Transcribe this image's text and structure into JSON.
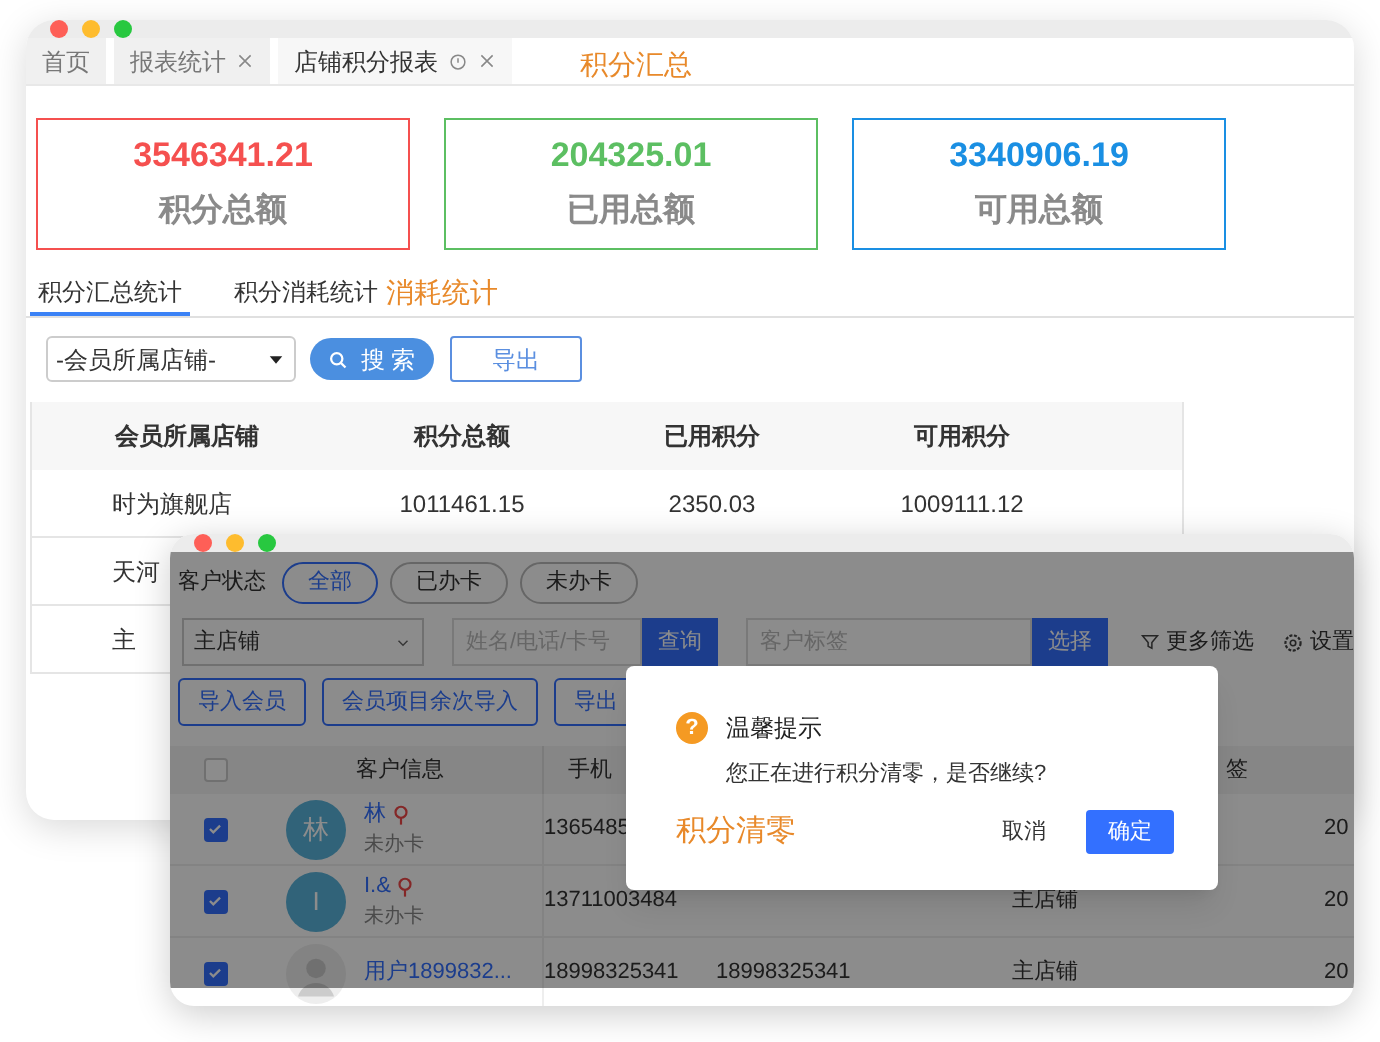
{
  "main_window": {
    "tabs": [
      {
        "label": "首页",
        "closable": false,
        "selected": false
      },
      {
        "label": "报表统计",
        "closable": true,
        "selected": false
      },
      {
        "label": "店铺积分报表",
        "closable": true,
        "selected": true
      }
    ],
    "tab_note": "积分汇总",
    "summary_cards": [
      {
        "value": "3546341.21",
        "label": "积分总额",
        "color": "#f5504f"
      },
      {
        "value": "204325.01",
        "label": "已用总额",
        "color": "#5cbf62"
      },
      {
        "value": "3340906.19",
        "label": "可用总额",
        "color": "#1a8fe3"
      }
    ],
    "sub_tabs": [
      {
        "label": "积分汇总统计",
        "selected": true
      },
      {
        "label": "积分消耗统计",
        "selected": false
      }
    ],
    "sub_tab_note": "消耗统计",
    "store_select": "-会员所属店铺-",
    "search_button": "搜 索",
    "export_button": "导出",
    "table": {
      "columns": [
        "会员所属店铺",
        "积分总额",
        "已用积分",
        "可用积分"
      ],
      "rows": [
        [
          "时为旗舰店",
          "1011461.15",
          "2350.03",
          "1009111.12"
        ],
        [
          "天河"
        ],
        [
          "主"
        ]
      ]
    }
  },
  "customer_window": {
    "status_filter": {
      "label": "客户状态",
      "options": [
        {
          "label": "全部",
          "selected": true
        },
        {
          "label": "已办卡",
          "selected": false
        },
        {
          "label": "未办卡",
          "selected": false
        }
      ]
    },
    "store_select": "主店铺",
    "name_search": {
      "placeholder": "姓名/电话/卡号",
      "button": "查询"
    },
    "tag_search": {
      "placeholder": "客户标签",
      "button": "选择"
    },
    "more_filters": "更多筛选",
    "column_settings": "设置",
    "actions": [
      "导入会员",
      "会员项目余次导入",
      "导出"
    ],
    "table": {
      "select_all_checked": false,
      "columns": [
        "客户信息",
        "手机",
        "签"
      ],
      "rows": [
        {
          "checked": true,
          "avatar": {
            "kind": "letter",
            "text": "林"
          },
          "name": "林",
          "tagged": true,
          "card_status": "未办卡",
          "phone": "1365485",
          "column_7": "20"
        },
        {
          "checked": true,
          "avatar": {
            "kind": "letter",
            "text": "I"
          },
          "name": "I.&",
          "tagged": true,
          "card_status": "未办卡",
          "phone": "13711003484",
          "store": "主店铺",
          "column_7": "20"
        },
        {
          "checked": true,
          "avatar": {
            "kind": "silhouette"
          },
          "name": "用户1899832...",
          "tagged": false,
          "phone": "18998325341",
          "phone_2": "18998325341",
          "store": "主店铺",
          "column_7": "20"
        }
      ]
    },
    "dialog": {
      "icon_glyph": "?",
      "title": "温馨提示",
      "message": "您正在进行积分清零，是否继续?",
      "note": "积分清零",
      "cancel_button": "取消",
      "confirm_button": "确定"
    }
  }
}
